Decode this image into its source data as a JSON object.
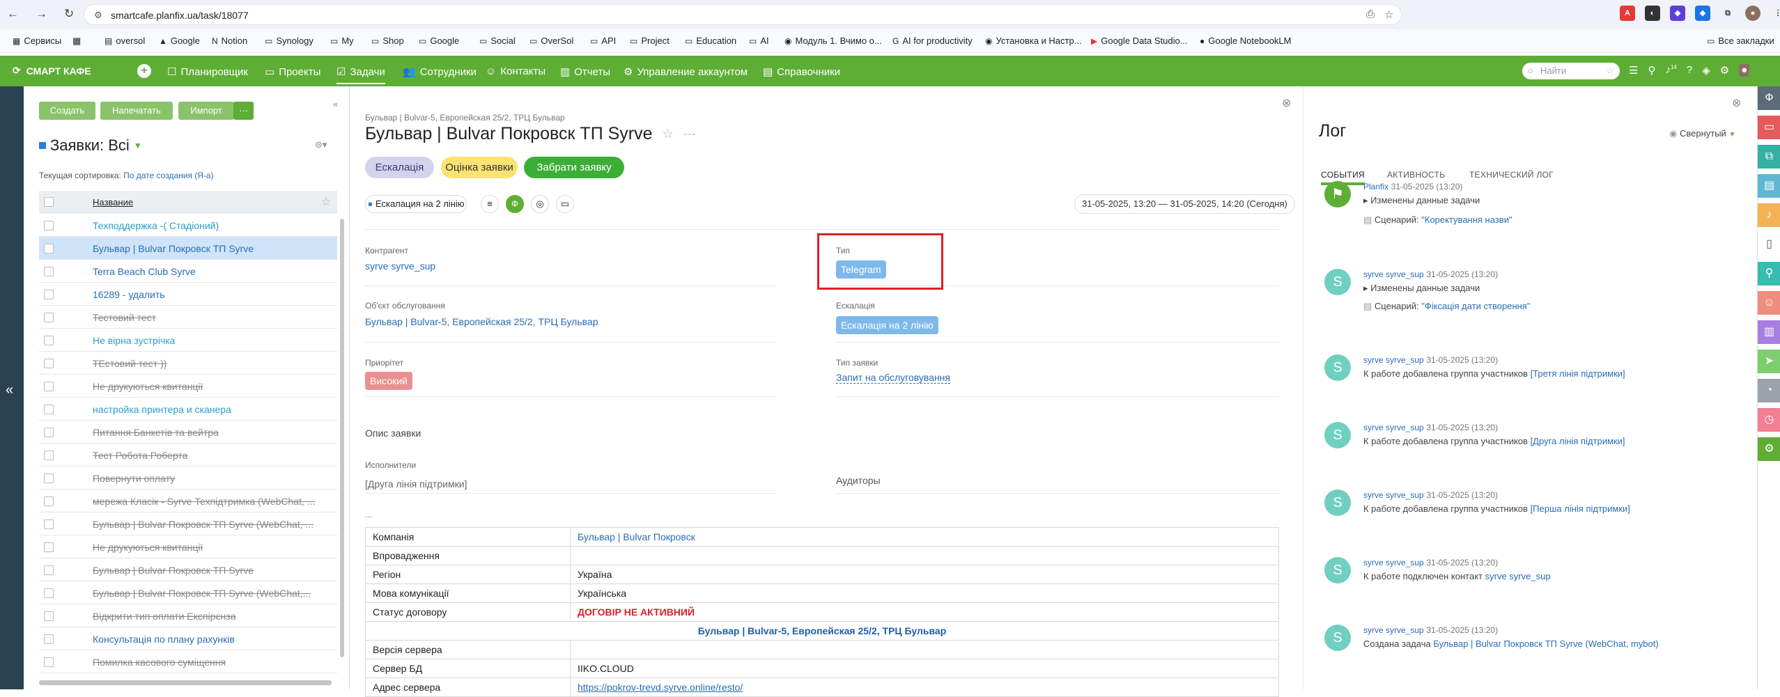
{
  "browser": {
    "url": "smartcafe.planfix.ua/task/18077",
    "all_bookmarks": "Все закладки",
    "bookmarks": [
      "Сервисы",
      "oversol",
      "Google",
      "Notion",
      "Synology",
      "My",
      "Shop",
      "Google",
      "Social",
      "OverSol",
      "API",
      "Project",
      "Education",
      "AI",
      "Модуль 1. Вчимо о...",
      "AI for productivity",
      "Установка и Настр...",
      "Google Data Studio...",
      "Google NotebookLM"
    ]
  },
  "header": {
    "logo": "СМАРТ КАФЕ",
    "nav": [
      "Планировщик",
      "Проекты",
      "Задачи",
      "Сотрудники",
      "Контакты",
      "Отчеты",
      "Управление аккаунтом",
      "Справочники"
    ],
    "active_nav": "Задачи",
    "search_placeholder": "Найти",
    "badge": "14"
  },
  "list": {
    "buttons": [
      "Создать",
      "Напечатать",
      "Импорт",
      "···"
    ],
    "title": "Заявки: Всі",
    "sort_label": "Текущая сортировка:",
    "sort_value": "По дате создания (Я-а)",
    "column": "Название",
    "rows": [
      {
        "text": "Техподдержка -( Стадіоний)",
        "style": "cyan"
      },
      {
        "text": "Бульвар | Bulvar Покровск ТП Syrve",
        "style": "link",
        "selected": true
      },
      {
        "text": "Terra Beach Club Syrve",
        "style": "link"
      },
      {
        "text": "16289 - удалить",
        "style": "link"
      },
      {
        "text": "Тестовий тест",
        "style": "strike"
      },
      {
        "text": "Не вірна зустрічка",
        "style": "cyan"
      },
      {
        "text": "ТЕстовий тест ))",
        "style": "strike"
      },
      {
        "text": "Не друкуються квитанції",
        "style": "strike"
      },
      {
        "text": "настройка принтера и сканера",
        "style": "cyan"
      },
      {
        "text": "Питання Банкетів та вейтра",
        "style": "strike"
      },
      {
        "text": "Тест Робота Роберта",
        "style": "strike"
      },
      {
        "text": "Повернути оплату",
        "style": "strike"
      },
      {
        "text": "мережа Класік - Syrve Техпідтримка (WebChat, ...",
        "style": "strike"
      },
      {
        "text": "Бульвар | Bulvar Покровск ТП Syrve (WebChat, ...",
        "style": "strike"
      },
      {
        "text": "Не друкуються квитанції",
        "style": "strike"
      },
      {
        "text": "Бульвар | Bulvar Покровск ТП Syrve",
        "style": "strike"
      },
      {
        "text": "Бульвар | Bulvar Покровск ТП Syrve (WebChat,...",
        "style": "strike"
      },
      {
        "text": "Відкрити тип оплати Експірєнза",
        "style": "strike"
      },
      {
        "text": "Консультація по плану рахунків",
        "style": "link"
      },
      {
        "text": "Помилка касового суміщення",
        "style": "strike"
      }
    ]
  },
  "task": {
    "breadcrumbs": "Бульвар | Bulvar-5, Европейская 25/2, ТРЦ Бульвар",
    "title": "Бульвар | Bulvar Покровск ТП Syrve",
    "pills": [
      "Ескалація",
      "Оцінка заявки",
      "Забрати заявку"
    ],
    "status_chip": "Ескалация на 2 лінію",
    "dates": "31-05-2025, 13:20 — 31-05-2025, 14:20  (Сегодня)",
    "fields": {
      "kontragent_label": "Контрагент",
      "kontragent": "syrve syrve_sup",
      "type_label": "Тип",
      "type": "Telegram",
      "object_label": "Об'єкт обслуговання",
      "object": "Бульвар | Bulvar-5, Европейская 25/2, ТРЦ Бульвар",
      "escalation_label": "Ескалація",
      "escalation": "Ескалація на 2 лінію",
      "priority_label": "Приорітет",
      "priority": "Високий",
      "request_type_label": "Тип заявки",
      "request_type": "Запит на обслуговування",
      "description_label": "Опис заявки",
      "executors_label": "Исполнители",
      "executors": "[Друга лінія підтримки]",
      "auditors_label": "Аудиторы",
      "dots": "..."
    },
    "info": {
      "company_l": "Компанія",
      "company_v": "Бульвар | Bulvar Покровск",
      "impl_l": "Впровадження",
      "region_l": "Регіон",
      "region_v": "Україна",
      "lang_l": "Мова комунікації",
      "lang_v": "Українська",
      "contract_l": "Статус договору",
      "contract_v": "ДОГОВІР НЕ АКТИВНИЙ",
      "object_row": "Бульвар | Bulvar-5, Европейская 25/2, ТРЦ Бульвар",
      "server_ver_l": "Версія сервера",
      "db_l": "Сервер БД",
      "db_v": "IIKO.CLOUD",
      "addr_l": "Адрес сервера",
      "addr_v": "https://pokrov-trevd.syrve.online/resto/"
    }
  },
  "log": {
    "title": "Лог",
    "mode": "Свернутый",
    "tabs": [
      "СОБЫТИЯ",
      "АКТИВНОСТЬ",
      "ТЕХНИЧЕСКИЙ ЛОГ"
    ],
    "e1": {
      "who": "Planfix",
      "date": "31-05-2025 (13:20)",
      "line1": "Изменены данные задачи",
      "scen_l": "Сценарий:",
      "scen": "\"Коректування назви\""
    },
    "e2": {
      "who": "syrve syrve_sup",
      "date": "31-05-2025 (13:20)",
      "line1": "Изменены данные задачи",
      "scen_l": "Сценарий:",
      "scen": "\"Фіксація дати створення\""
    },
    "e3": {
      "who": "syrve syrve_sup",
      "date": "31-05-2025 (13:20)",
      "text": "К работе добавлена группа участников",
      "grp": "[Третя лінія підтримки]"
    },
    "e4": {
      "who": "syrve syrve_sup",
      "date": "31-05-2025 (13:20)",
      "text": "К работе добавлена группа участников",
      "grp": "[Друга лінія підтримки]"
    },
    "e5": {
      "who": "syrve syrve_sup",
      "date": "31-05-2025 (13:20)",
      "text": "К работе добавлена группа участников",
      "grp": "[Перша лінія підтримки]"
    },
    "e6": {
      "who": "syrve syrve_sup",
      "date": "31-05-2025 (13:20)",
      "text": "К работе подключен контакт",
      "grp": "syrve syrve_sup"
    },
    "e7": {
      "who": "syrve syrve_sup",
      "date": "31-05-2025 (13:20)",
      "text": "Создана задача",
      "grp": "Бульвар | Bulvar Покровск ТП Syrve (WebChat, mybot)"
    },
    "avatar": "S"
  },
  "colors": {
    "green": "#5eae35",
    "link": "#2a6db5",
    "red": "#d92128"
  }
}
